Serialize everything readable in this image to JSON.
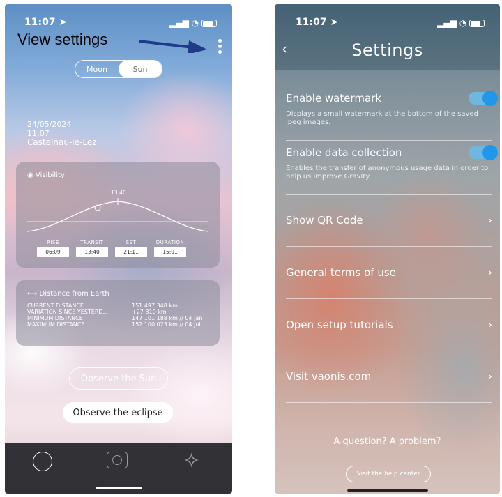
{
  "annotation": {
    "text": "View settings"
  },
  "left_phone": {
    "status_time": "11:07",
    "toggle": {
      "options": [
        "Moon",
        "Sun"
      ],
      "selected": "Sun"
    },
    "info": {
      "date": "24/05/2024",
      "time": "11:07",
      "location": "Castelnau-le-Lez"
    },
    "visibility": {
      "title": "Visibility",
      "peak_label": "13:40",
      "stats": [
        {
          "label": "RISE",
          "value": "06:09"
        },
        {
          "label": "TRANSIT",
          "value": "13:40"
        },
        {
          "label": "SET",
          "value": "21:11"
        },
        {
          "label": "DURATION",
          "value": "15:01"
        }
      ]
    },
    "distance": {
      "title": "Distance from Earth",
      "rows": [
        {
          "label": "CURRENT DISTANCE",
          "value": "151 497 348 km"
        },
        {
          "label": "VARIATION SINCE YESTERD...",
          "value": "+27 810 km"
        },
        {
          "label": "MINIMUM DISTANCE",
          "value": "147 101 188 km // 04 Jan"
        },
        {
          "label": "MAXIMUM DISTANCE",
          "value": "152 100 023 km // 04 Jul"
        }
      ]
    },
    "buttons": {
      "observe_sun": "Observe the Sun",
      "observe_eclipse": "Observe the eclipse"
    }
  },
  "right_phone": {
    "status_time": "11:07",
    "title": "Settings",
    "settings": [
      {
        "name": "Enable watermark",
        "description": "Displays a small watermark at the bottom of the saved jpeg images.",
        "enabled": true
      },
      {
        "name": "Enable data collection",
        "description": "Enables the transfer of anonymous usage data in order to help us improve Gravity.",
        "enabled": true
      }
    ],
    "links": [
      "Show QR Code",
      "General terms of use",
      "Open setup tutorials",
      "Visit vaonis.com"
    ],
    "question": "A question? A problem?",
    "help_button": "Visit the help center"
  }
}
